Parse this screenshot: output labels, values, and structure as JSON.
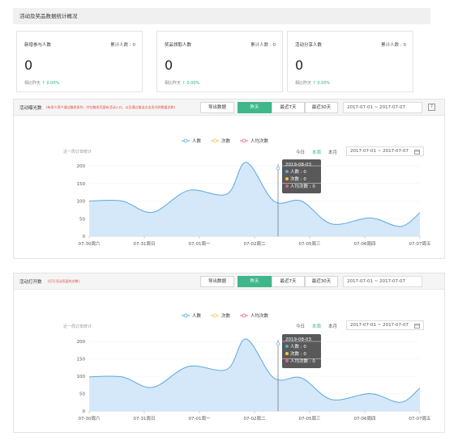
{
  "header": {
    "title": "活动及奖品数据统计概况"
  },
  "stats": [
    {
      "label": "新增参与人数",
      "total": "累计人数 : 0",
      "value": "0",
      "compare_prefix": "相比昨天",
      "compare_value": "0.00%"
    },
    {
      "label": "奖品领取人数",
      "total": "累计人数 : 0",
      "value": "0",
      "compare_prefix": "相比昨天",
      "compare_value": "0.00%"
    },
    {
      "label": "活动分享人数",
      "total": "累计人数 : 0",
      "value": "0",
      "compare_prefix": "相比昨天",
      "compare_value": "0.00%"
    }
  ],
  "panels": [
    {
      "title": "活动曝光数",
      "note": "(有多少用户通过触发条件，并在触发页面有活动入口，以及通过推送点击形式的数量总和)",
      "export_label": "导出数据",
      "ranges": [
        "昨天",
        "最近7天",
        "最近30天"
      ],
      "active_range": "昨天",
      "date_range": "2017-07-01 ~ 2017-07-07",
      "help": "?",
      "subtitle": "近一周订单统计",
      "periods": [
        "今日",
        "本周",
        "本月"
      ],
      "active_period": "本周",
      "chart_date_range": "2017-07-01 ~ 2017-07-07",
      "tooltip": {
        "date": "2019-08-03",
        "rows": [
          "人数 : 0",
          "次数 : 0",
          "人均次数 : 0"
        ]
      }
    },
    {
      "title": "活动打开数",
      "note": "(打开活动页面的次数)",
      "export_label": "导出数据",
      "ranges": [
        "昨天",
        "最近7天",
        "最近30天"
      ],
      "active_range": "昨天",
      "date_range": "2017-07-01 ~ 2017-07-07",
      "help": "",
      "subtitle": "近一周订单统计",
      "periods": [
        "今日",
        "本周",
        "本月"
      ],
      "active_period": "本周",
      "chart_date_range": "2017-07-01 ~ 2017-07-07",
      "tooltip": {
        "date": "2019-08-03",
        "rows": [
          "人数 : 0",
          "次数 : 0",
          "人均次数 : 0"
        ]
      }
    }
  ],
  "colors": {
    "accent": "#3fb78a",
    "series_people": "#5aa9e0",
    "series_times": "#f5c242",
    "series_avg": "#e0637a",
    "area_fill": "#cfe6f8",
    "up": "#2bb673"
  },
  "chart_data": [
    {
      "type": "area",
      "title": "",
      "categories": [
        "07-30周六",
        "07-31周日",
        "07-01周一",
        "07-02周二",
        "07-05周三",
        "07-06周四",
        "07-07周五"
      ],
      "y_ticks": [
        0,
        50,
        100,
        150,
        200
      ],
      "ylim": [
        0,
        220
      ],
      "legend": [
        "人数",
        "次数",
        "人均次数"
      ],
      "legend_position": "top-center",
      "series": [
        {
          "name": "人数",
          "points": [
            [
              0,
              100
            ],
            [
              0.6,
              100
            ],
            [
              1.15,
              68
            ],
            [
              1.8,
              130
            ],
            [
              2.5,
              120
            ],
            [
              2.85,
              210
            ],
            [
              3.35,
              100
            ],
            [
              3.85,
              100
            ],
            [
              4.4,
              35
            ],
            [
              5.1,
              52
            ],
            [
              5.65,
              28
            ],
            [
              6.0,
              67
            ]
          ]
        }
      ]
    },
    {
      "type": "area",
      "title": "",
      "categories": [
        "07-30周六",
        "07-31周日",
        "07-01周一",
        "07-02周二",
        "07-05周三",
        "07-06周四",
        "07-07周五"
      ],
      "y_ticks": [
        0,
        50,
        100,
        150,
        200
      ],
      "ylim": [
        0,
        220
      ],
      "legend": [
        "人数",
        "次数",
        "人均次数"
      ],
      "legend_position": "top-center",
      "series": [
        {
          "name": "人数",
          "points": [
            [
              0,
              98
            ],
            [
              0.6,
              98
            ],
            [
              1.15,
              68
            ],
            [
              1.8,
              128
            ],
            [
              2.5,
              120
            ],
            [
              2.85,
              207
            ],
            [
              3.35,
              95
            ],
            [
              3.85,
              95
            ],
            [
              4.4,
              33
            ],
            [
              5.1,
              50
            ],
            [
              5.65,
              25
            ],
            [
              6.0,
              66
            ]
          ]
        }
      ]
    }
  ]
}
